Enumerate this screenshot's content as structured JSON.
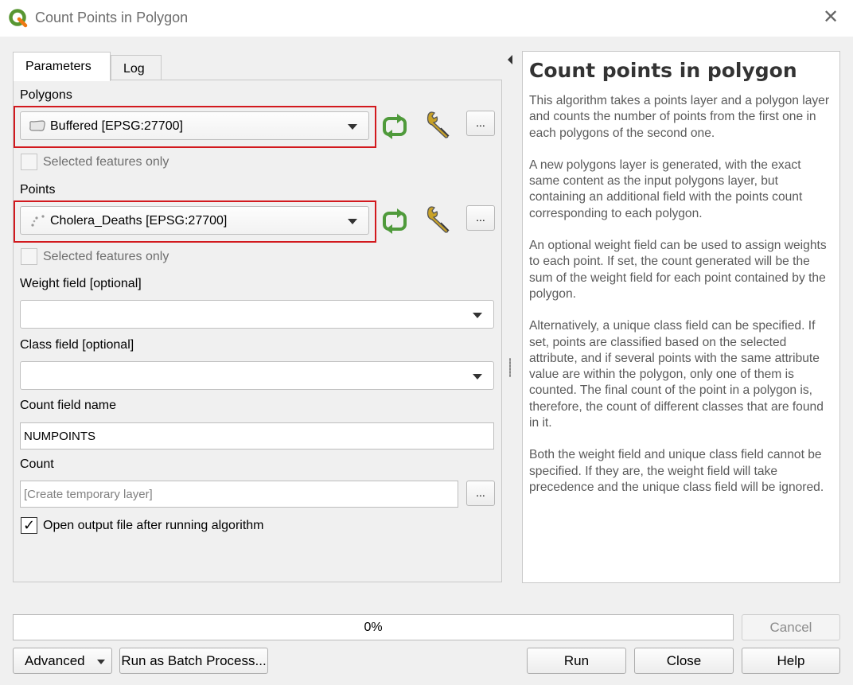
{
  "window": {
    "title": "Count Points in Polygon",
    "close_glyph": "✕"
  },
  "tabs": [
    {
      "label": "Parameters"
    },
    {
      "label": "Log"
    }
  ],
  "params": {
    "polygons": {
      "label": "Polygons",
      "value": "Buffered [EPSG:27700]",
      "selected_only": "Selected features only"
    },
    "points": {
      "label": "Points",
      "value": "Cholera_Deaths [EPSG:27700]",
      "selected_only": "Selected features only"
    },
    "weight": {
      "label": "Weight field [optional]",
      "value": ""
    },
    "class": {
      "label": "Class field [optional]",
      "value": ""
    },
    "count_field": {
      "label": "Count field name",
      "value": "NUMPOINTS"
    },
    "count": {
      "label": "Count",
      "placeholder": "[Create temporary layer]"
    },
    "open_output": {
      "label": "Open output file after running algorithm",
      "checked": true,
      "check_glyph": "✓"
    },
    "dots_label": "..."
  },
  "help": {
    "title": "Count points in polygon",
    "paragraphs": [
      "This algorithm takes a points layer and a polygon layer and counts the number of points from the first one in each polygons of the second one.",
      "A new polygons layer is generated, with the exact same content as the input polygons layer, but containing an additional field with the points count corresponding to each polygon.",
      "An optional weight field can be used to assign weights to each point. If set, the count generated will be the sum of the weight field for each point contained by the polygon.",
      "Alternatively, a unique class field can be specified. If set, points are classified based on the selected attribute, and if several points with the same attribute value are within the polygon, only one of them is counted. The final count of the point in a polygon is, therefore, the count of different classes that are found in it.",
      "Both the weight field and unique class field cannot be specified. If they are, the weight field will take precedence and the unique class field will be ignored."
    ]
  },
  "progress": {
    "text": "0%",
    "fraction": 0
  },
  "buttons": {
    "cancel": "Cancel",
    "advanced": "Advanced",
    "batch": "Run as Batch Process...",
    "run": "Run",
    "close": "Close",
    "help": "Help"
  },
  "colors": {
    "highlight_border": "#d2191e",
    "qgis_green": "#589632",
    "refresh_green": "#6bb34a"
  },
  "icons": [
    "qgis-logo-icon",
    "close-icon",
    "polygon-layer-icon",
    "point-layer-icon",
    "iterate-icon",
    "wrench-icon",
    "chevron-down-icon",
    "collapse-arrow-icon"
  ]
}
